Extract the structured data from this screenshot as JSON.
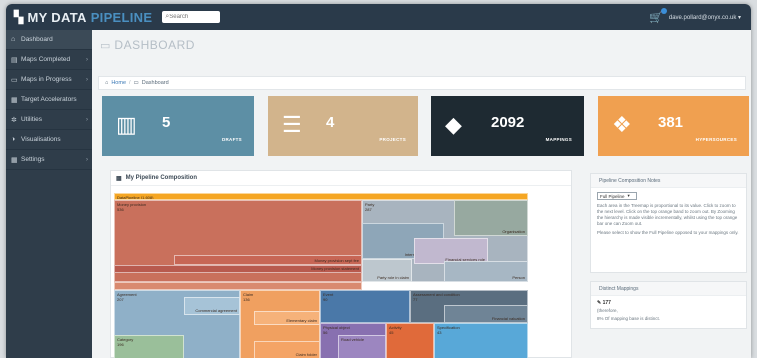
{
  "app": {
    "brand_left": "MY DATA",
    "brand_right": "PIPELINE",
    "search_placeholder": "Search",
    "user_email": "dave.pollard@onyx.co.uk ▾"
  },
  "sidebar": {
    "items": [
      {
        "label": "Dashboard",
        "icon": "dashboard-icon",
        "chev": ""
      },
      {
        "label": "Maps Completed",
        "icon": "list-icon",
        "chev": "›"
      },
      {
        "label": "Maps in Progress",
        "icon": "monitor-icon",
        "chev": "›"
      },
      {
        "label": "Target Accelerators",
        "icon": "grid-icon",
        "chev": ""
      },
      {
        "label": "Utilities",
        "icon": "gear-icon",
        "chev": "›"
      },
      {
        "label": "Visualisations",
        "icon": "pie-icon",
        "chev": ""
      },
      {
        "label": "Settings",
        "icon": "grid-icon",
        "chev": "›"
      }
    ]
  },
  "page": {
    "title": "DASHBOARD",
    "breadcrumb": {
      "home": "Home",
      "current": "Dashboard",
      "separator": "/"
    }
  },
  "tiles": [
    {
      "value": "5",
      "label": "DRAFTS",
      "color": "#5d8fa5"
    },
    {
      "value": "4",
      "label": "PROJECTS",
      "color": "#d2b48c"
    },
    {
      "value": "2092",
      "label": "MAPPINGS",
      "color": "#1e2a32"
    },
    {
      "value": "381",
      "label": "HYPERSOURCES",
      "color": "#f0a050"
    }
  ],
  "composition": {
    "title": "My Pipeline Composition",
    "root_label": "DataPipeline (1,608)",
    "cells": [
      {
        "label": "Money provision\n536",
        "color": "#c9705c"
      },
      {
        "label": "Party\n287",
        "color": "#a8b4bf"
      },
      {
        "label": "Money provision sept fee",
        "color": ""
      },
      {
        "label": "Money provision statement",
        "color": ""
      },
      {
        "label": "Internal organisation",
        "color": ""
      },
      {
        "label": "Organisation",
        "color": ""
      },
      {
        "label": "Financial services role",
        "color": ""
      },
      {
        "label": "Party role in claim",
        "color": ""
      },
      {
        "label": "Person",
        "color": ""
      },
      {
        "label": "Agreement\n207",
        "color": "#8fb0c8"
      },
      {
        "label": "Commercial agreement",
        "color": ""
      },
      {
        "label": "Category\n196",
        "color": "#9abf9a"
      },
      {
        "label": "Claim\n136",
        "color": "#f0a060"
      },
      {
        "label": "Elementary claim",
        "color": ""
      },
      {
        "label": "Claim folder",
        "color": ""
      },
      {
        "label": "Event\n90",
        "color": "#4a78a8"
      },
      {
        "label": "Assessment and condition\n77",
        "color": "#5a6e80"
      },
      {
        "label": "Financial valuation",
        "color": ""
      },
      {
        "label": "Physical object\n56",
        "color": "#8870b0"
      },
      {
        "label": "Activity\n45",
        "color": "#e06a3a"
      },
      {
        "label": "Specification\n43",
        "color": "#58a8d8"
      },
      {
        "label": "Road vehicle",
        "color": ""
      }
    ]
  },
  "notes": {
    "title": "Pipeline Composition Notes",
    "select_value": "Full Pipeline",
    "text1": "Each area in the Treemap is proportional to its value. Click to zoom to the next level. Click on the top orange band to zoom out. By Zooming the hierarchy is made visible incrementally, whilst using the top orange bar one can Zoom out.",
    "text2": "Please select to show the Full Pipeline opposed to your mappings only."
  },
  "distinct": {
    "title": "Distinct Mappings",
    "value": "177",
    "text1": "(therefore,",
    "text2": "8% Of mapping base is distinct."
  }
}
